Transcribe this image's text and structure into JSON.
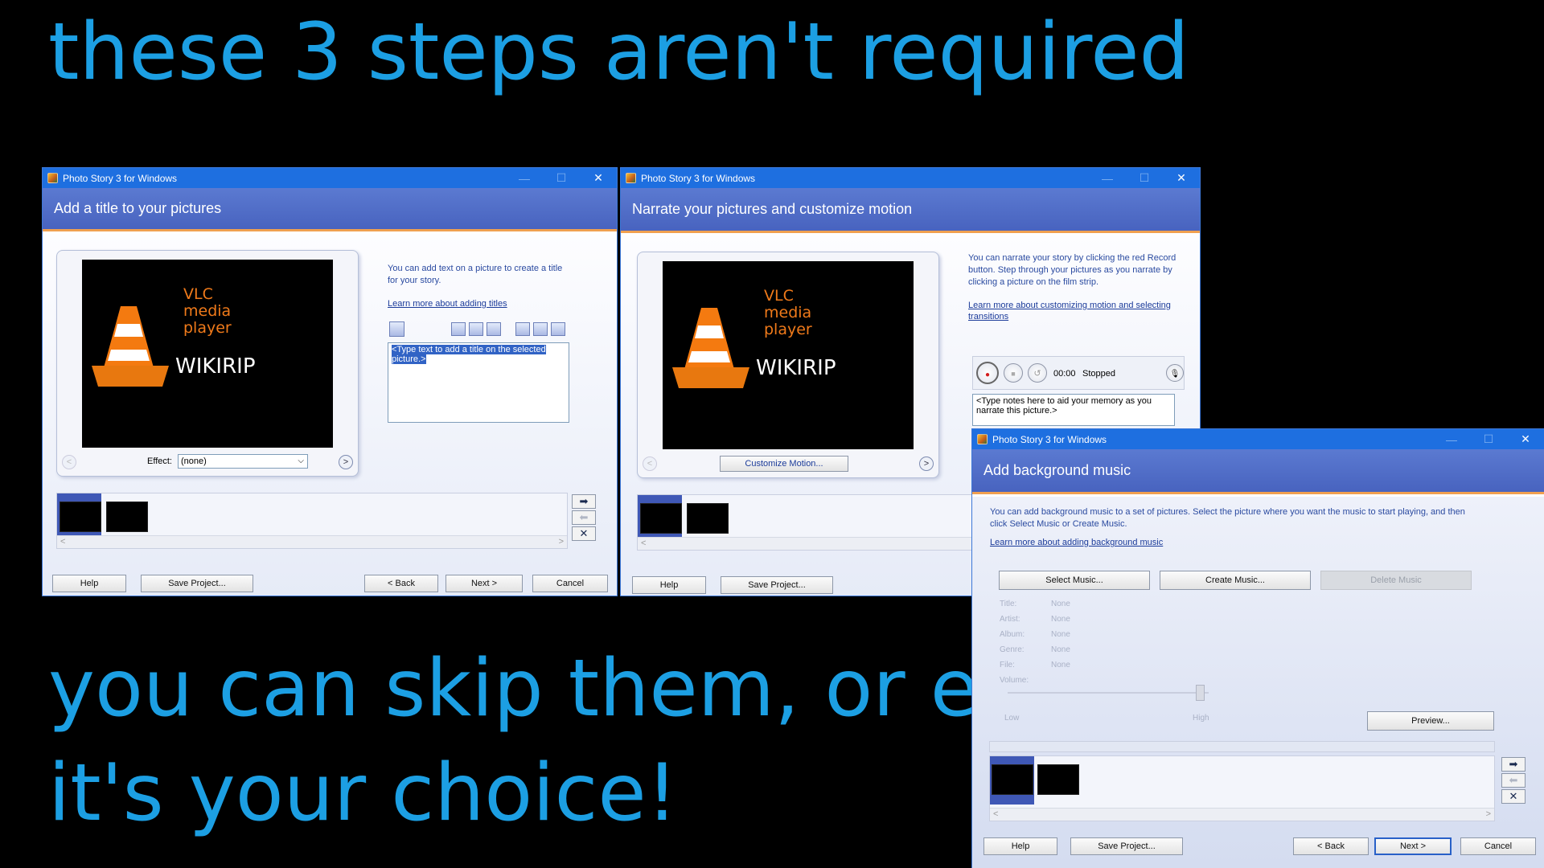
{
  "captions": {
    "line1": "these 3 steps aren't required",
    "line2": "you can skip them, or edit",
    "line3": "it's your choice!"
  },
  "app_title": "Photo Story 3 for Windows",
  "window_controls": {
    "minimize": "—",
    "maximize": "☐",
    "close": "✕"
  },
  "thumbnail_text": {
    "vlc_line1": "VLC",
    "vlc_line2": "media",
    "vlc_line3": "player",
    "wikirip": "WIKIRIP"
  },
  "common_buttons": {
    "help": "Help",
    "save_project": "Save Project...",
    "back": "< Back",
    "next": "Next >",
    "cancel": "Cancel"
  },
  "filmstrip_controls": {
    "right_arrow": "➡",
    "left_arrow": "⬅",
    "remove": "✕",
    "scroll_left": "<",
    "scroll_right": ">"
  },
  "nav_arrows": {
    "prev": "<",
    "next": ">"
  },
  "title_window": {
    "header": "Add a title to your pictures",
    "info": "You can add text on a picture to create a title for your story.",
    "link": "Learn more about adding titles",
    "textbox_value": "<Type text to add a title on the selected picture.>",
    "effect_label": "Effect:",
    "effect_value": "(none)"
  },
  "narrate_window": {
    "header": "Narrate your pictures and customize motion",
    "info": "You can narrate your story by clicking the red Record button. Step through your pictures as you narrate by clicking a picture on the film strip.",
    "link": "Learn more about customizing motion and selecting transitions",
    "time": "00:00",
    "status": "Stopped",
    "notes_value": "<Type notes here to aid your memory as you narrate this picture.>",
    "customize_motion": "Customize Motion..."
  },
  "music_window": {
    "header": "Add background music",
    "info": "You can add background music to a set of pictures.  Select the picture where you want the music to start playing, and then click Select Music or Create Music.",
    "link": "Learn more about adding background music",
    "select_music": "Select Music...",
    "create_music": "Create Music...",
    "delete_music": "Delete Music",
    "fields": [
      {
        "label": "Title:",
        "value": "None"
      },
      {
        "label": "Artist:",
        "value": "None"
      },
      {
        "label": "Album:",
        "value": "None"
      },
      {
        "label": "Genre:",
        "value": "None"
      },
      {
        "label": "File:",
        "value": "None"
      },
      {
        "label": "Volume:",
        "value": ""
      }
    ],
    "volume_low": "Low",
    "volume_high": "High",
    "preview": "Preview..."
  },
  "colors": {
    "caption": "#1c9fe3",
    "titlebar": "#1e6fe0",
    "header": "#4863bf",
    "accent_line": "#f0a050",
    "vlc_orange": "#f07a1a"
  }
}
